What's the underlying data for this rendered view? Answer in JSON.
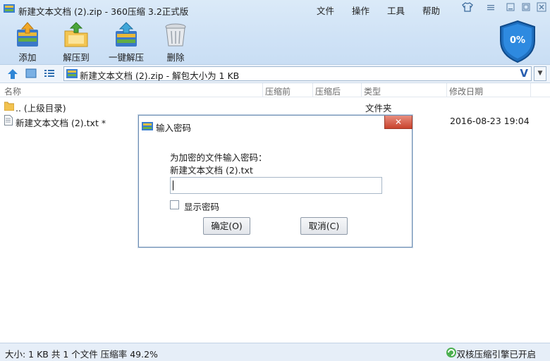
{
  "window": {
    "title": "新建文本文档 (2).zip - 360压缩 3.2正式版",
    "menu": [
      "文件",
      "操作",
      "工具",
      "帮助"
    ]
  },
  "toolbar": {
    "add": "添加",
    "extract_to": "解压到",
    "one_click_extract": "一键解压",
    "delete": "删除"
  },
  "shield": {
    "percent": "0%"
  },
  "address": {
    "path": "新建文本文档 (2).zip - 解包大小为 1 KB",
    "v_glyph": "V"
  },
  "columns": [
    "名称",
    "压缩前",
    "压缩后",
    "类型",
    "修改日期"
  ],
  "files": [
    {
      "name": ".. (上级目录)",
      "type": "文件夹",
      "date": ""
    },
    {
      "name": "新建文本文档 (2).txt *",
      "type": "",
      "date": "2016-08-23 19:04"
    }
  ],
  "status": {
    "left": "大小: 1 KB 共 1 个文件 压缩率 49.2%",
    "right": "双核压缩引擎已开启"
  },
  "dialog": {
    "title": "输入密码",
    "message_line1": "为加密的文件输入密码：",
    "message_line2": "新建文本文档 (2).txt",
    "password_value": "",
    "show_password_label": "显示密码",
    "ok_label": "确定(O)",
    "cancel_label": "取消(C)",
    "close_glyph": "✕"
  },
  "colors": {
    "title_bg": "#d6e7f7",
    "shield_blue": "#1f6fbf",
    "dialog_close_red": "#c9432d"
  }
}
